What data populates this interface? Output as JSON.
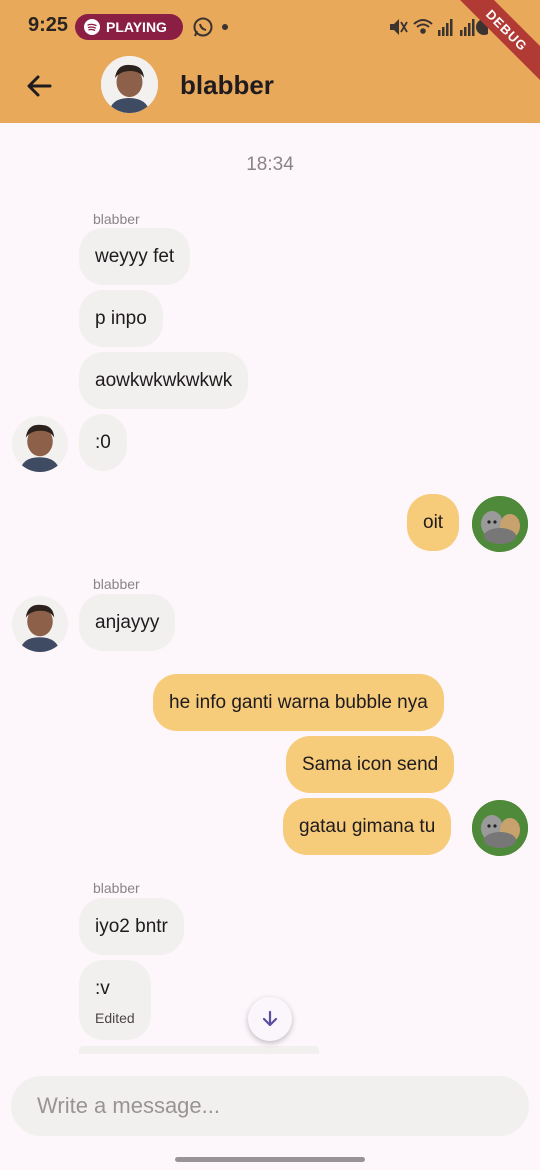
{
  "status_bar": {
    "time": "9:25",
    "media_pill": "PLAYING",
    "debug_label": "DEBUG"
  },
  "header": {
    "back_icon": "arrow-left-icon",
    "title": "blabber"
  },
  "chat": {
    "timestamp": "18:34",
    "messages": [
      {
        "sender": "blabber",
        "text": "weyyy fet"
      },
      {
        "text": "p inpo"
      },
      {
        "text": "aowkwkwkwkwk"
      },
      {
        "text": ":0"
      },
      {
        "text": "oit"
      },
      {
        "sender": "blabber",
        "text": "anjayyy"
      },
      {
        "text": "he info ganti warna bubble nya"
      },
      {
        "text": "Sama icon send"
      },
      {
        "text": "gatau gimana tu"
      },
      {
        "sender": "blabber",
        "text": "iyo2 bntr"
      },
      {
        "text": ":v",
        "status": "Edited"
      }
    ]
  },
  "composer": {
    "placeholder": "Write a message..."
  },
  "colors": {
    "header_bg": "#e9a95a",
    "outgoing_bubble": "#f6cb7a",
    "incoming_bubble": "#f2f0ef",
    "page_bg": "#fdf7fb"
  }
}
